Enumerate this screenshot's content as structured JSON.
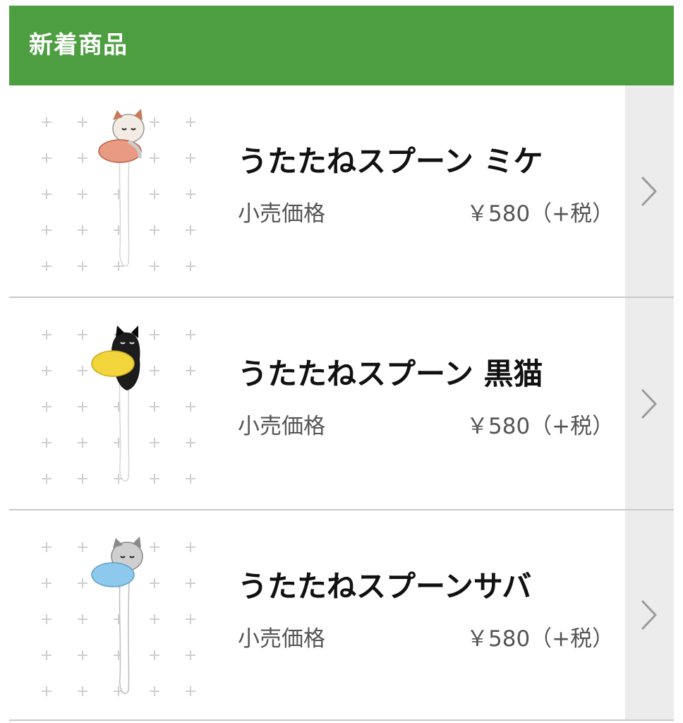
{
  "header": {
    "title": "新着商品"
  },
  "products": [
    {
      "name": "うたたねスプーン ミケ",
      "price_label": "小売価格",
      "price": "￥580（+税）",
      "head_color": "#f3ece4",
      "accent_color": "#d98466",
      "bowl_color": "#e89a82"
    },
    {
      "name": "うたたねスプーン 黒猫",
      "price_label": "小売価格",
      "price": "￥580（+税）",
      "head_color": "#1c1c1c",
      "accent_color": "#0c0c0c",
      "bowl_color": "#f2d53a"
    },
    {
      "name": "うたたねスプーンサバ",
      "price_label": "小売価格",
      "price": "￥580（+税）",
      "head_color": "#cfcfcf",
      "accent_color": "#8a8a8a",
      "bowl_color": "#8cc9ec"
    }
  ],
  "colors": {
    "header_bg": "#4c9e40",
    "arrow_bg": "#ececec",
    "divider": "#c9c9c9"
  },
  "icons": {
    "row_arrow": "chevron-right-icon"
  }
}
